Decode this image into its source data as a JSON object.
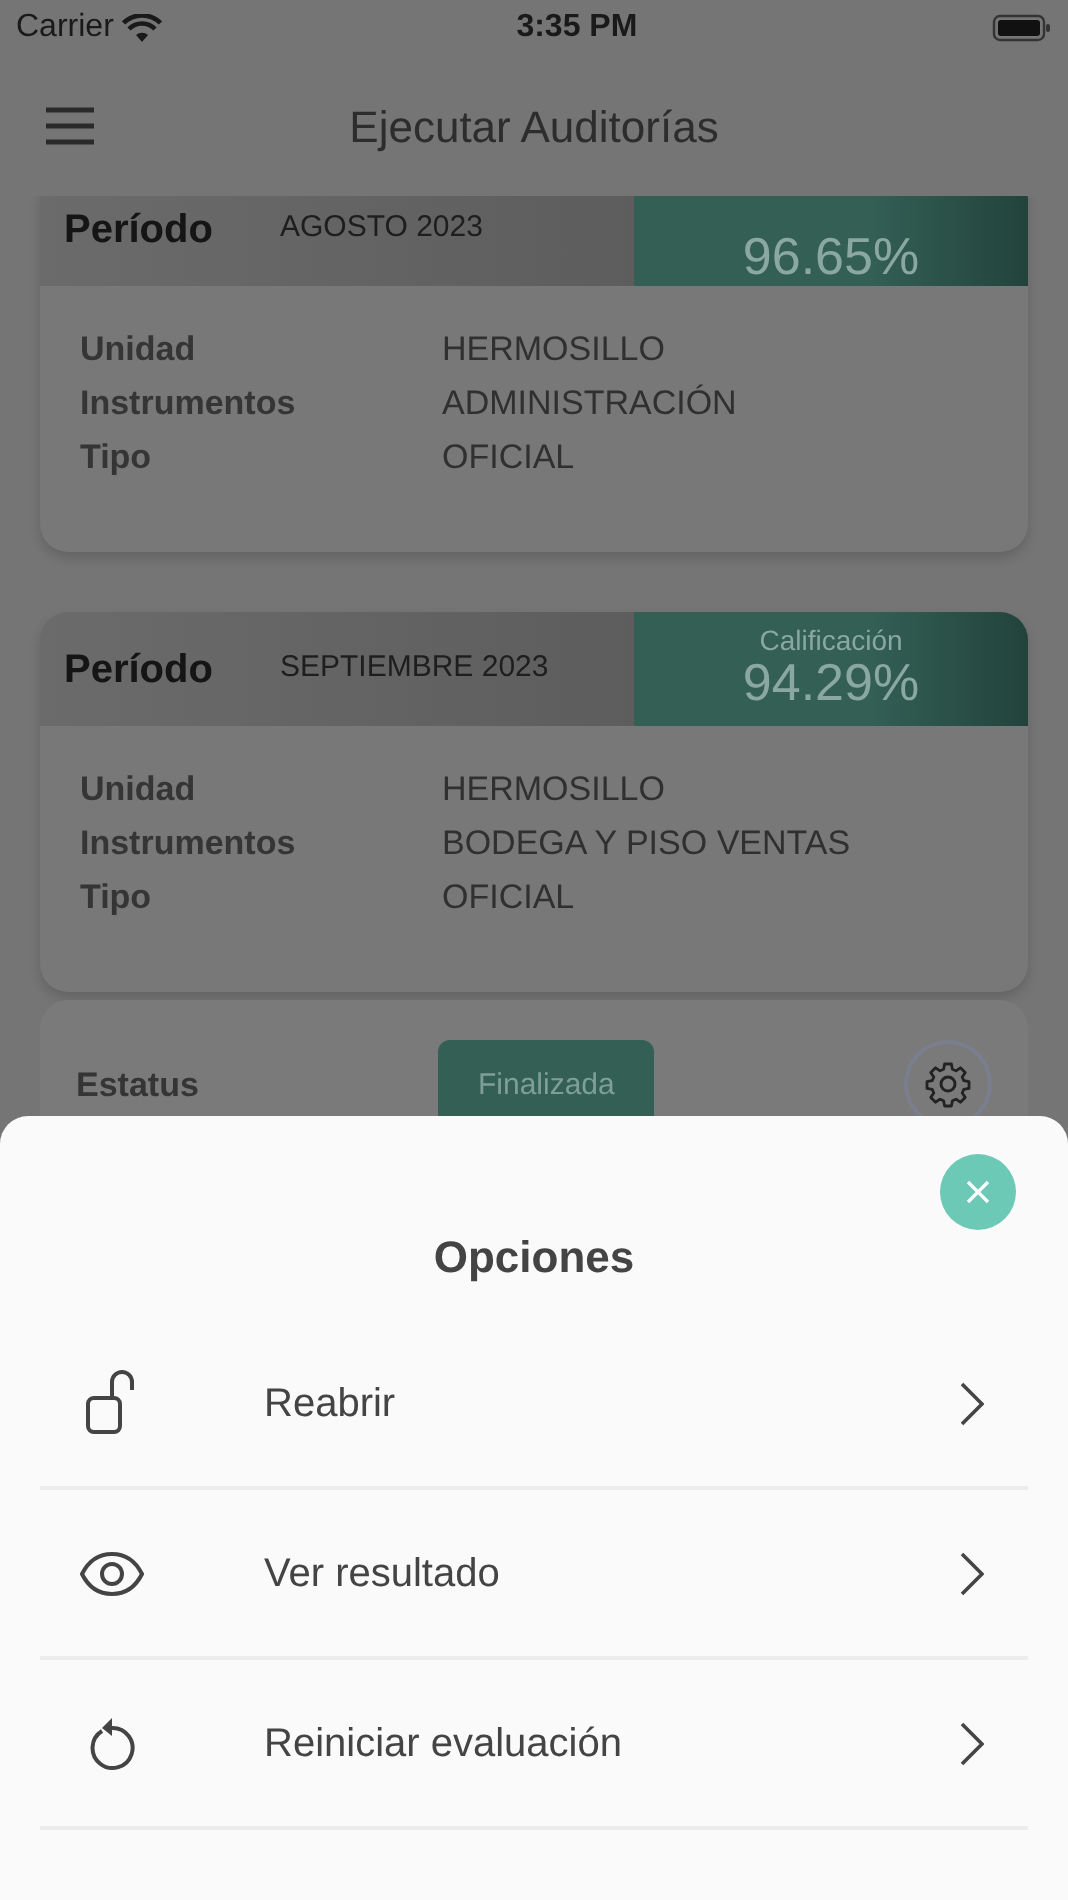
{
  "status_bar": {
    "carrier": "Carrier",
    "time": "3:35 PM"
  },
  "header": {
    "title": "Ejecutar Auditorías"
  },
  "cards": [
    {
      "period_label": "Período",
      "period": "AGOSTO 2023",
      "score": "96.65%",
      "fields": [
        {
          "label": "Unidad",
          "value": "HERMOSILLO"
        },
        {
          "label": "Instrumentos",
          "value": "ADMINISTRACIÓN"
        },
        {
          "label": "Tipo",
          "value": "OFICIAL"
        }
      ]
    },
    {
      "period_label": "Período",
      "period": "SEPTIEMBRE 2023",
      "score_label": "Calificación",
      "score": "94.29%",
      "fields": [
        {
          "label": "Unidad",
          "value": "HERMOSILLO"
        },
        {
          "label": "Instrumentos",
          "value": "BODEGA Y PISO VENTAS"
        },
        {
          "label": "Tipo",
          "value": "OFICIAL"
        }
      ]
    }
  ],
  "status_card": {
    "label": "Estatus",
    "status": "Finalizada"
  },
  "sheet": {
    "title": "Opciones",
    "options": [
      {
        "kind": "unlock",
        "label": "Reabrir"
      },
      {
        "kind": "eye",
        "label": "Ver resultado"
      },
      {
        "kind": "restart",
        "label": "Reiniciar evaluación"
      }
    ]
  }
}
